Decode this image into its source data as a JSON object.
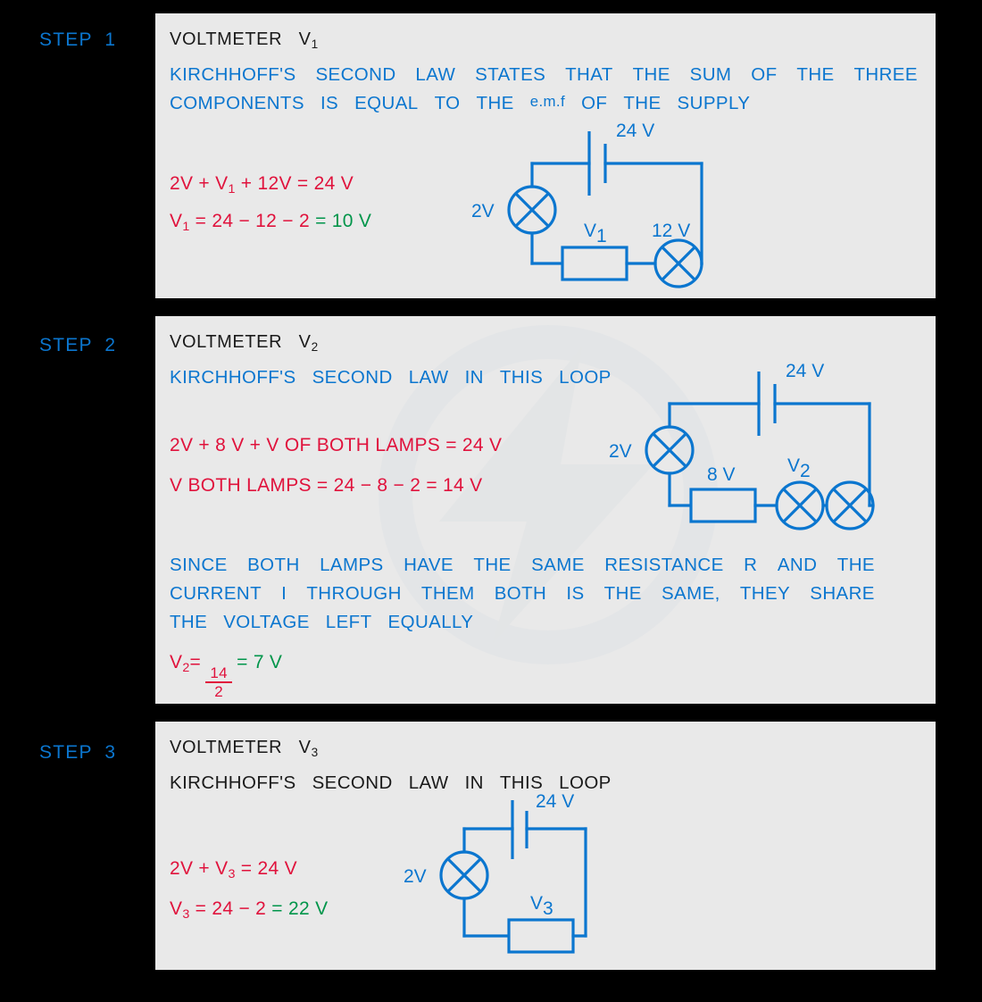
{
  "steps": [
    {
      "label": "STEP  1",
      "title_prefix": "VOLTMETER   V",
      "title_sub": "1",
      "body_lines": [
        [
          "KIRCHHOFF'S",
          "SECOND",
          "LAW",
          "STATES",
          "THAT",
          "THE",
          "SUM",
          "OF",
          "THE",
          "THREE"
        ],
        [
          "COMPONENTS",
          "IS",
          "EQUAL",
          "TO",
          "THE",
          "e.m.f",
          "OF",
          "THE",
          "SUPPLY"
        ]
      ],
      "body_color": "#0b76cf",
      "equations": [
        {
          "red": "2V + V",
          "sub": "1",
          "red2": " + 12V = 24 V",
          "green": ""
        },
        {
          "red": "V",
          "sub": "1",
          "red2": " = 24 − 12 − 2 ",
          "green": "= 10 V"
        }
      ],
      "circuit": {
        "battery_label": "24 V",
        "lamp_left_label": "2V",
        "resistor_label": "V",
        "resistor_sub": "1",
        "lamp_right_label": "12 V"
      }
    },
    {
      "label": "STEP  2",
      "title_prefix": "VOLTMETER   V",
      "title_sub": "2",
      "body_lines": [
        [
          "KIRCHHOFF'S",
          "SECOND",
          "LAW",
          "IN",
          "THIS",
          "LOOP"
        ]
      ],
      "body_color": "#0b76cf",
      "equations": [
        {
          "red": "2V + 8 V + V   OF  BOTH  LAMPS = 24 V",
          "sub": "",
          "red2": "",
          "green": ""
        },
        {
          "red": "V BOTH  LAMPS = 24 − 8 − 2 = 14 V",
          "sub": "",
          "red2": "",
          "green": ""
        }
      ],
      "paragraph": [
        [
          "SINCE",
          "BOTH",
          "LAMPS",
          "HAVE",
          "THE",
          "SAME",
          "RESISTANCE",
          "R",
          "AND",
          "THE"
        ],
        [
          "CURRENT",
          "I",
          "THROUGH",
          "THEM",
          "BOTH",
          "IS",
          "THE",
          "SAME,",
          "THEY",
          "SHARE"
        ],
        [
          "THE",
          "VOLTAGE",
          "LEFT",
          "EQUALLY"
        ]
      ],
      "fraction_eq": {
        "lhs": "V",
        "lhs_sub": "2",
        "eq": "=",
        "numerator": "14",
        "denominator": "2",
        "result": "= 7 V"
      },
      "circuit": {
        "battery_label": "24 V",
        "lamp_left_label": "2V",
        "resistor_label": "8 V",
        "voltmeter_label": "V",
        "voltmeter_sub": "2"
      }
    },
    {
      "label": "STEP  3",
      "title_prefix": "VOLTMETER   V",
      "title_sub": "3",
      "body_lines": [
        [
          "KIRCHHOFF'S",
          "SECOND",
          "LAW",
          "IN",
          "THIS",
          "LOOP"
        ]
      ],
      "body_color": "#1a1a1a",
      "equations": [
        {
          "red": "2V + V",
          "sub": "3",
          "red2": " = 24 V",
          "green": ""
        },
        {
          "red": "V",
          "sub": "3",
          "red2": " = 24 − 2 ",
          "green": "= 22 V"
        }
      ],
      "circuit": {
        "battery_label": "24 V",
        "lamp_left_label": "2V",
        "resistor_label": "V",
        "resistor_sub": "3"
      }
    }
  ],
  "colors": {
    "background": "#000000",
    "panel": "#e9e9e9",
    "blue": "#0b76cf",
    "red": "#e0123c",
    "green": "#00954a",
    "black": "#1a1a1a"
  }
}
